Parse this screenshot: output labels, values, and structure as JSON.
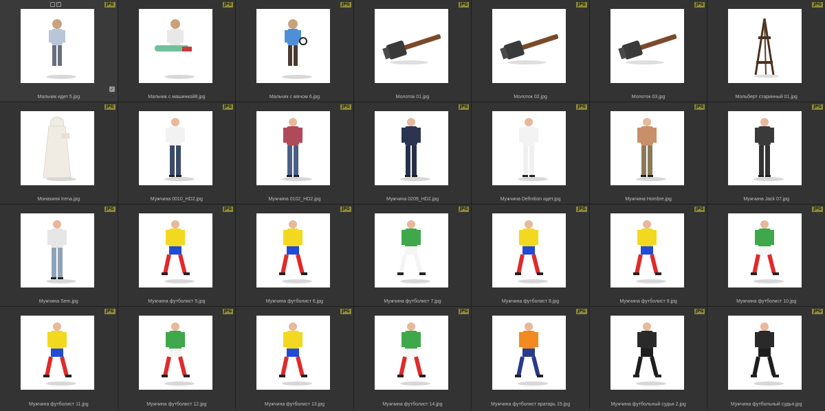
{
  "badge_label": "JPG",
  "colors": {
    "badge": "#8c8a3a",
    "background": "#333333",
    "caption": "#bdbdbd"
  },
  "items": [
    {
      "label": "Мальчик идет 5.jpg",
      "kind": "child",
      "shirt": "#b8c6d8",
      "pants": "#6a6f7d",
      "icon": "figure-thumbnail"
    },
    {
      "label": "Мальчик с машинкой8.jpg",
      "kind": "child-sit",
      "shirt": "#e8e8e8",
      "pants": "#6fbf9a",
      "icon": "figure-thumbnail"
    },
    {
      "label": "Мальчик с мячом 6.jpg",
      "kind": "child",
      "shirt": "#4f8fd6",
      "pants": "#4a3a32",
      "icon": "figure-thumbnail"
    },
    {
      "label": "Молоток 01.jpg",
      "kind": "hammer",
      "icon": "hammer-thumbnail"
    },
    {
      "label": "Молоток 02.jpg",
      "kind": "hammer",
      "icon": "hammer-thumbnail"
    },
    {
      "label": "Молоток 03.jpg",
      "kind": "hammer",
      "icon": "hammer-thumbnail"
    },
    {
      "label": "Мольберт старинный 01.jpg",
      "kind": "easel",
      "icon": "easel-thumbnail"
    },
    {
      "label": "Монахиня Irena.jpg",
      "kind": "robe",
      "shirt": "#f0ece4",
      "pants": "#f0ece4",
      "icon": "figure-thumbnail"
    },
    {
      "label": "Мужчина 0010_HD2.jpg",
      "kind": "man",
      "shirt": "#f2f2f2",
      "pants": "#3b4a66",
      "icon": "figure-thumbnail"
    },
    {
      "label": "Мужчина 0102_HD2.jpg",
      "kind": "man",
      "shirt": "#b04a5a",
      "pants": "#4a5f86",
      "icon": "figure-thumbnail"
    },
    {
      "label": "Мужчина 0209_HD2.jpg",
      "kind": "man",
      "shirt": "#2b3552",
      "pants": "#263049",
      "icon": "figure-thumbnail"
    },
    {
      "label": "Мужчина Definition идет.jpg",
      "kind": "man",
      "shirt": "#f3f3f3",
      "pants": "#f0f0f0",
      "icon": "figure-thumbnail"
    },
    {
      "label": "Мужчина Hombre.jpg",
      "kind": "man",
      "shirt": "#c98e6a",
      "pants": "#8a7a5a",
      "icon": "figure-thumbnail"
    },
    {
      "label": "Мужчина Jack 07.jpg",
      "kind": "man",
      "shirt": "#3a3a3a",
      "pants": "#333333",
      "icon": "figure-thumbnail"
    },
    {
      "label": "Мужчина Sem.jpg",
      "kind": "man",
      "shirt": "#e6e6e6",
      "pants": "#8fa3b8",
      "icon": "figure-thumbnail"
    },
    {
      "label": "Мужчина футболист 5.jpg",
      "kind": "player",
      "shirt": "#f2d91f",
      "pants": "#1f4bd6",
      "socks": "#e02a2a",
      "icon": "figure-thumbnail"
    },
    {
      "label": "Мужчина футболист 6.jpg",
      "kind": "player",
      "shirt": "#f2d91f",
      "pants": "#1f4bd6",
      "socks": "#e02a2a",
      "icon": "figure-thumbnail"
    },
    {
      "label": "Мужчина футболист 7.jpg",
      "kind": "player",
      "shirt": "#3fa84a",
      "pants": "#f5f5f5",
      "socks": "#f5f5f5",
      "icon": "figure-thumbnail"
    },
    {
      "label": "Мужчина футболист 8.jpg",
      "kind": "player",
      "shirt": "#f2d91f",
      "pants": "#1f4bd6",
      "socks": "#e02a2a",
      "icon": "figure-thumbnail"
    },
    {
      "label": "Мужчина футболист 9.jpg",
      "kind": "player",
      "shirt": "#f2d91f",
      "pants": "#1f4bd6",
      "socks": "#e02a2a",
      "icon": "figure-thumbnail"
    },
    {
      "label": "Мужчина футболист 10.jpg",
      "kind": "player",
      "shirt": "#3fa84a",
      "pants": "#f5f5f5",
      "socks": "#e02a2a",
      "icon": "figure-thumbnail"
    },
    {
      "label": "Мужчина футболист 11.jpg",
      "kind": "player",
      "shirt": "#f2d91f",
      "pants": "#1f4bd6",
      "socks": "#e02a2a",
      "icon": "figure-thumbnail"
    },
    {
      "label": "Мужчина футболист 12.jpg",
      "kind": "player",
      "shirt": "#3fa84a",
      "pants": "#f5f5f5",
      "socks": "#e02a2a",
      "icon": "figure-thumbnail"
    },
    {
      "label": "Мужчина футболист 13.jpg",
      "kind": "player",
      "shirt": "#f2d91f",
      "pants": "#1f4bd6",
      "socks": "#e02a2a",
      "icon": "figure-thumbnail"
    },
    {
      "label": "Мужчина футболист 14.jpg",
      "kind": "player",
      "shirt": "#3fa84a",
      "pants": "#f5f5f5",
      "socks": "#e02a2a",
      "icon": "figure-thumbnail"
    },
    {
      "label": "Мужчина футболист вратарь 15.jpg",
      "kind": "player",
      "shirt": "#f28a1f",
      "pants": "#2a3a8a",
      "socks": "#2a3a8a",
      "icon": "figure-thumbnail"
    },
    {
      "label": "Мужчина футбольный судья 2.jpg",
      "kind": "player",
      "shirt": "#2a2a2a",
      "pants": "#1e1e1e",
      "socks": "#1e1e1e",
      "icon": "figure-thumbnail"
    },
    {
      "label": "Мужчина футбольный судья.jpg",
      "kind": "player",
      "shirt": "#2a2a2a",
      "pants": "#1e1e1e",
      "socks": "#1e1e1e",
      "icon": "figure-thumbnail"
    }
  ]
}
